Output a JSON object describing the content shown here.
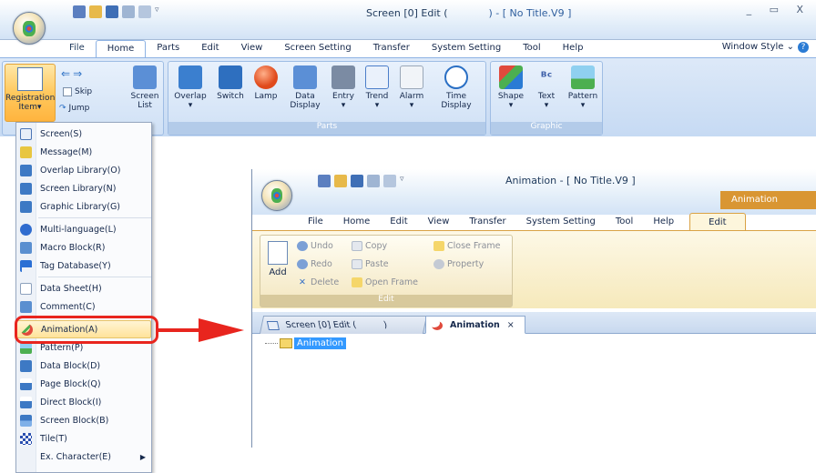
{
  "main_window": {
    "title": "Screen [0] Edit (",
    "title_suffix": ") - [ No Title.V9 ]",
    "window_controls": "_ ▭ X",
    "tabs": [
      "File",
      "Home",
      "Parts",
      "Edit",
      "View",
      "Screen Setting",
      "Transfer",
      "System Setting",
      "Tool",
      "Help"
    ],
    "active_tab": "Home",
    "window_style_label": "Window Style",
    "ribbon": {
      "registration_item_label": "Registration",
      "registration_item_label2": "Item",
      "skip_label": "Skip",
      "jump_label": "Jump",
      "screen_list_label": "Screen",
      "screen_list_label2": "List",
      "parts_buttons": [
        "Overlap",
        "Switch",
        "Lamp",
        "Data\nDisplay",
        "Entry",
        "Trend",
        "Alarm",
        "Time\nDisplay"
      ],
      "parts_group_label": "Parts",
      "graphic_buttons": [
        "Shape",
        "Text",
        "Pattern"
      ],
      "graphic_group_label": "Graphic",
      "icon_colors": {
        "overlap": "#3b7fcf",
        "switch": "#2e6fbf",
        "lamp": "#e04a1c",
        "data_display": "#5b8fd6",
        "entry": "#7b8ba3",
        "trend": "#4c7ec9",
        "alarm": "#9aa7b8",
        "time_display": "#2a6fc4",
        "shape": "#2a7bd4",
        "text": "#3c5fa8",
        "pattern": "#4caf50"
      }
    }
  },
  "menu": {
    "items": [
      {
        "label": "Screen(S)",
        "icon": "screen-icon",
        "color": "#4a74b5"
      },
      {
        "label": "Message(M)",
        "icon": "message-icon",
        "color": "#e8c640"
      },
      {
        "label": "Overlap Library(O)",
        "icon": "overlap-library-icon",
        "color": "#3d79c4"
      },
      {
        "label": "Screen Library(N)",
        "icon": "screen-library-icon",
        "color": "#3d79c4"
      },
      {
        "label": "Graphic Library(G)",
        "icon": "graphic-library-icon",
        "color": "#3d79c4"
      },
      {
        "label": "Multi-language(L)",
        "icon": "multi-language-icon",
        "color": "#2f6ccf"
      },
      {
        "label": "Macro Block(R)",
        "icon": "macro-block-icon",
        "color": "#5a8fd0"
      },
      {
        "label": "Tag Database(Y)",
        "icon": "tag-database-icon",
        "color": "#2a6fd4"
      },
      {
        "label": "Data Sheet(H)",
        "icon": "data-sheet-icon",
        "color": "#8da1bd"
      },
      {
        "label": "Comment(C)",
        "icon": "comment-icon",
        "color": "#5a8fd0"
      },
      {
        "label": "Animation(A)",
        "icon": "animation-icon",
        "color": "#e04a3c"
      },
      {
        "label": "Pattern(P)",
        "icon": "pattern-icon",
        "color": "#4caf50"
      },
      {
        "label": "Data Block(D)",
        "icon": "data-block-icon",
        "color": "#3d79c4"
      },
      {
        "label": "Page Block(Q)",
        "icon": "page-block-icon",
        "color": "#3d79c4"
      },
      {
        "label": "Direct Block(I)",
        "icon": "direct-block-icon",
        "color": "#3d79c4"
      },
      {
        "label": "Screen Block(B)",
        "icon": "screen-block-icon",
        "color": "#3d79c4"
      },
      {
        "label": "Tile(T)",
        "icon": "tile-icon",
        "color": "#2a4fb0"
      },
      {
        "label": "Ex. Character(E)",
        "icon": "ex-character-icon",
        "color": "#ffffff"
      }
    ],
    "highlighted": "Animation(A)",
    "callout_color": "#e8251e"
  },
  "animation_window": {
    "title": "Animation - [ No Title.V9 ]",
    "context_tab": "Animation",
    "tabs": [
      "File",
      "Home",
      "Edit",
      "View",
      "Transfer",
      "System Setting",
      "Tool",
      "Help",
      "Edit"
    ],
    "active_tab": "Edit",
    "ribbon": {
      "add_label": "Add",
      "undo_label": "Undo",
      "redo_label": "Redo",
      "delete_label": "Delete",
      "copy_label": "Copy",
      "paste_label": "Paste",
      "open_frame_label": "Open Frame",
      "close_frame_label": "Close Frame",
      "property_label": "Property",
      "group_label": "Edit"
    },
    "doc_tabs": {
      "screen_tab": "Screen [0] Edit (          )",
      "animation_tab": "Animation",
      "close_glyph": "×"
    },
    "tree_node": "Animation"
  }
}
